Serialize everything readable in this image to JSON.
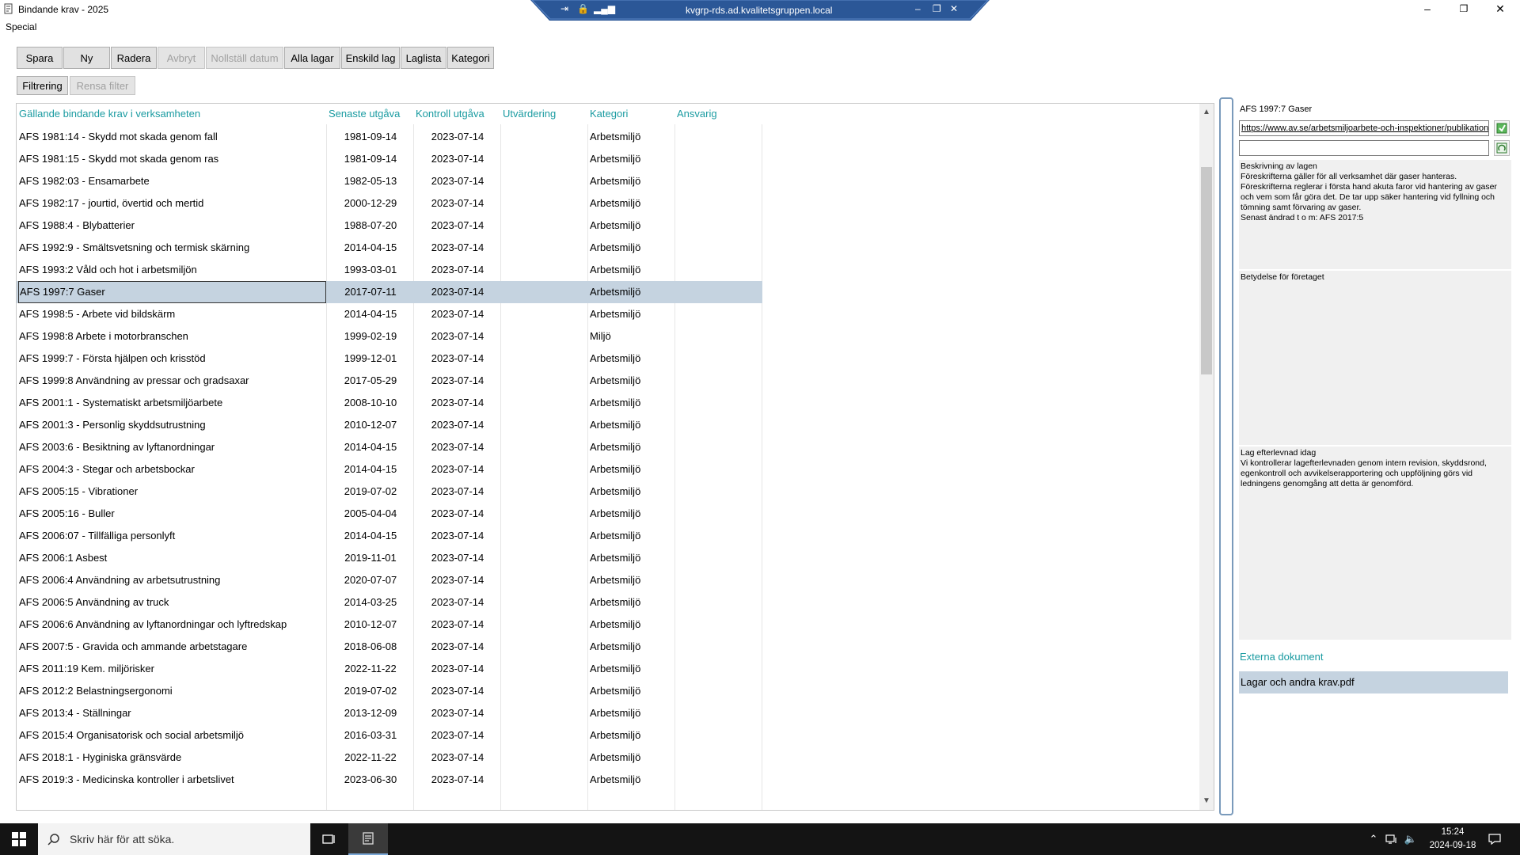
{
  "window": {
    "title": "Bindande krav - 2025",
    "remote_host": "kvgrp-rds.ad.kvalitetsgruppen.local",
    "minimize": "–",
    "restore": "❐",
    "close": "✕"
  },
  "menu": {
    "special": "Special"
  },
  "toolbar": {
    "spara": "Spara",
    "ny": "Ny",
    "radera": "Radera",
    "avbryt": "Avbryt",
    "nollstall": "Nollställ datum",
    "alla_lagar": "Alla lagar",
    "enskild_lag": "Enskild lag",
    "laglista": "Laglista",
    "kategori": "Kategori",
    "filtrering": "Filtrering",
    "rensa_filter": "Rensa filter"
  },
  "grid": {
    "headers": [
      "Gällande bindande krav i verksamheten",
      "Senaste utgåva",
      "Kontroll utgåva",
      "Utvärdering",
      "Kategori",
      "Ansvarig"
    ],
    "selected_index": 7,
    "rows": [
      [
        "AFS 1981:14 - Skydd mot skada genom fall",
        "1981-09-14",
        "2023-07-14",
        "",
        "Arbetsmiljö",
        ""
      ],
      [
        "AFS 1981:15 - Skydd mot skada genom ras",
        "1981-09-14",
        "2023-07-14",
        "",
        "Arbetsmiljö",
        ""
      ],
      [
        "AFS 1982:03 - Ensamarbete",
        "1982-05-13",
        "2023-07-14",
        "",
        "Arbetsmiljö",
        ""
      ],
      [
        "AFS 1982:17 - jourtid, övertid och mertid",
        "2000-12-29",
        "2023-07-14",
        "",
        "Arbetsmiljö",
        ""
      ],
      [
        "AFS 1988:4 - Blybatterier",
        "1988-07-20",
        "2023-07-14",
        "",
        "Arbetsmiljö",
        ""
      ],
      [
        "AFS 1992:9 - Smältsvetsning och termisk skärning",
        "2014-04-15",
        "2023-07-14",
        "",
        "Arbetsmiljö",
        ""
      ],
      [
        "AFS 1993:2 Våld och hot i arbetsmiljön",
        "1993-03-01",
        "2023-07-14",
        "",
        "Arbetsmiljö",
        ""
      ],
      [
        "AFS 1997:7 Gaser",
        "2017-07-11",
        "2023-07-14",
        "",
        "Arbetsmiljö",
        ""
      ],
      [
        "AFS 1998:5 - Arbete vid bildskärm",
        "2014-04-15",
        "2023-07-14",
        "",
        "Arbetsmiljö",
        ""
      ],
      [
        "AFS 1998:8 Arbete i motorbranschen",
        "1999-02-19",
        "2023-07-14",
        "",
        "Miljö",
        ""
      ],
      [
        "AFS 1999:7 - Första hjälpen och krisstöd",
        "1999-12-01",
        "2023-07-14",
        "",
        "Arbetsmiljö",
        ""
      ],
      [
        "AFS 1999:8 Användning av pressar och gradsaxar",
        "2017-05-29",
        "2023-07-14",
        "",
        "Arbetsmiljö",
        ""
      ],
      [
        "AFS 2001:1 - Systematiskt arbetsmiljöarbete",
        "2008-10-10",
        "2023-07-14",
        "",
        "Arbetsmiljö",
        ""
      ],
      [
        "AFS 2001:3 - Personlig skyddsutrustning",
        "2010-12-07",
        "2023-07-14",
        "",
        "Arbetsmiljö",
        ""
      ],
      [
        "AFS 2003:6 - Besiktning av lyftanordningar",
        "2014-04-15",
        "2023-07-14",
        "",
        "Arbetsmiljö",
        ""
      ],
      [
        "AFS 2004:3 - Stegar och arbetsbockar",
        "2014-04-15",
        "2023-07-14",
        "",
        "Arbetsmiljö",
        ""
      ],
      [
        "AFS 2005:15 - Vibrationer",
        "2019-07-02",
        "2023-07-14",
        "",
        "Arbetsmiljö",
        ""
      ],
      [
        "AFS 2005:16 - Buller",
        "2005-04-04",
        "2023-07-14",
        "",
        "Arbetsmiljö",
        ""
      ],
      [
        "AFS 2006:07 - Tillfälliga personlyft",
        "2014-04-15",
        "2023-07-14",
        "",
        "Arbetsmiljö",
        ""
      ],
      [
        "AFS 2006:1 Asbest",
        "2019-11-01",
        "2023-07-14",
        "",
        "Arbetsmiljö",
        ""
      ],
      [
        "AFS 2006:4 Användning av arbetsutrustning",
        "2020-07-07",
        "2023-07-14",
        "",
        "Arbetsmiljö",
        ""
      ],
      [
        "AFS 2006:5 Användning av truck",
        "2014-03-25",
        "2023-07-14",
        "",
        "Arbetsmiljö",
        ""
      ],
      [
        "AFS 2006:6 Användning av lyftanordningar och lyftredskap",
        "2010-12-07",
        "2023-07-14",
        "",
        "Arbetsmiljö",
        ""
      ],
      [
        "AFS 2007:5 - Gravida och ammande arbetstagare",
        "2018-06-08",
        "2023-07-14",
        "",
        "Arbetsmiljö",
        ""
      ],
      [
        "AFS 2011:19 Kem. miljörisker",
        "2022-11-22",
        "2023-07-14",
        "",
        "Arbetsmiljö",
        ""
      ],
      [
        "AFS 2012:2 Belastningsergonomi",
        "2019-07-02",
        "2023-07-14",
        "",
        "Arbetsmiljö",
        ""
      ],
      [
        "AFS 2013:4 - Ställningar",
        "2013-12-09",
        "2023-07-14",
        "",
        "Arbetsmiljö",
        ""
      ],
      [
        "AFS 2015:4 Organisatorisk och social arbetsmiljö",
        "2016-03-31",
        "2023-07-14",
        "",
        "Arbetsmiljö",
        ""
      ],
      [
        "AFS 2018:1 - Hyginiska gränsvärde",
        "2022-11-22",
        "2023-07-14",
        "",
        "Arbetsmiljö",
        ""
      ],
      [
        "AFS 2019:3 - Medicinska kontroller i arbetslivet",
        "2023-06-30",
        "2023-07-14",
        "",
        "Arbetsmiljö",
        ""
      ]
    ]
  },
  "detail": {
    "title": "AFS 1997:7 Gaser",
    "url": "https://www.av.se/arbetsmiljoarbete-och-inspektioner/publikationer",
    "second_value": "",
    "beskrivning_label": "Beskrivning av lagen",
    "beskrivning_text": "Föreskrifterna gäller för all verksamhet där gaser hanteras. Föreskrifterna reglerar i första hand akuta faror vid hantering av gaser och vem som får göra det. De tar upp säker hantering vid fyllning och tömning samt förvaring av gaser.",
    "beskrivning_changed": "Senast ändrad t o m: AFS 2017:5",
    "betydelse_label": "Betydelse för företaget",
    "betydelse_text": "",
    "efterlevnad_label": "Lag efterlevnad idag",
    "efterlevnad_text": "Vi kontrollerar lagefterlevnaden genom intern revision, skyddsrond, egenkontroll och avvikelserapportering och uppföljning görs vid ledningens genomgång att detta är genomförd.",
    "externa_label": "Externa dokument",
    "externa_docs": [
      "Lagar och andra krav.pdf"
    ]
  },
  "taskbar": {
    "search_placeholder": "Skriv här för att söka.",
    "time": "15:24",
    "date": "2024-09-18"
  }
}
